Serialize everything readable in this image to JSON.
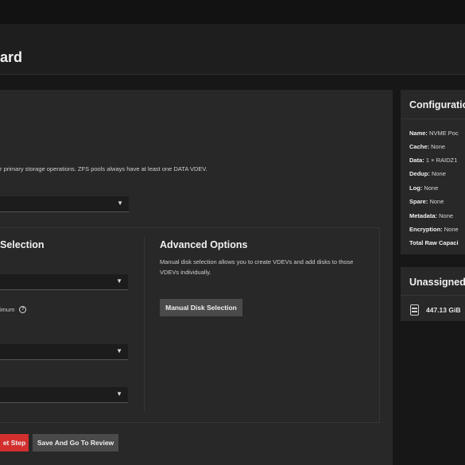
{
  "header": {
    "title": "ard"
  },
  "data_vdev": {
    "description": "r primary storage operations. ZFS pools always have at least one DATA VDEV.",
    "select_value": ""
  },
  "disk_selection": {
    "title": "Selection",
    "select1_value": "",
    "minimum_text": "imum",
    "select2_value": "",
    "select3_value": ""
  },
  "advanced": {
    "title": "Advanced Options",
    "description": "Manual disk selection allows you to create VDEVs and add disks to those VDEVs individually.",
    "manual_button": "Manual Disk Selection"
  },
  "footer": {
    "reset_button": "et Step",
    "review_button": "Save And Go To Review"
  },
  "configuration": {
    "title": "Configuratio",
    "rows": [
      {
        "label": "Name:",
        "value": "NVME Poc"
      },
      {
        "label": "Cache:",
        "value": "None"
      },
      {
        "label": "Data:",
        "value": "1 × RAIDZ1"
      },
      {
        "label": "Dedup:",
        "value": "None"
      },
      {
        "label": "Log:",
        "value": "None"
      },
      {
        "label": "Spare:",
        "value": "None"
      },
      {
        "label": "Metadata:",
        "value": "None"
      },
      {
        "label": "Encryption:",
        "value": "None"
      },
      {
        "label": "Total Raw Capaci",
        "value": ""
      }
    ]
  },
  "unassigned": {
    "title": "Unassigned",
    "disk_size": "447.13 GiB"
  },
  "colors": {
    "accent_red": "#d32f2f",
    "button_gray": "#4a4a4a",
    "card_bg": "#282828",
    "page_bg": "#171717"
  }
}
